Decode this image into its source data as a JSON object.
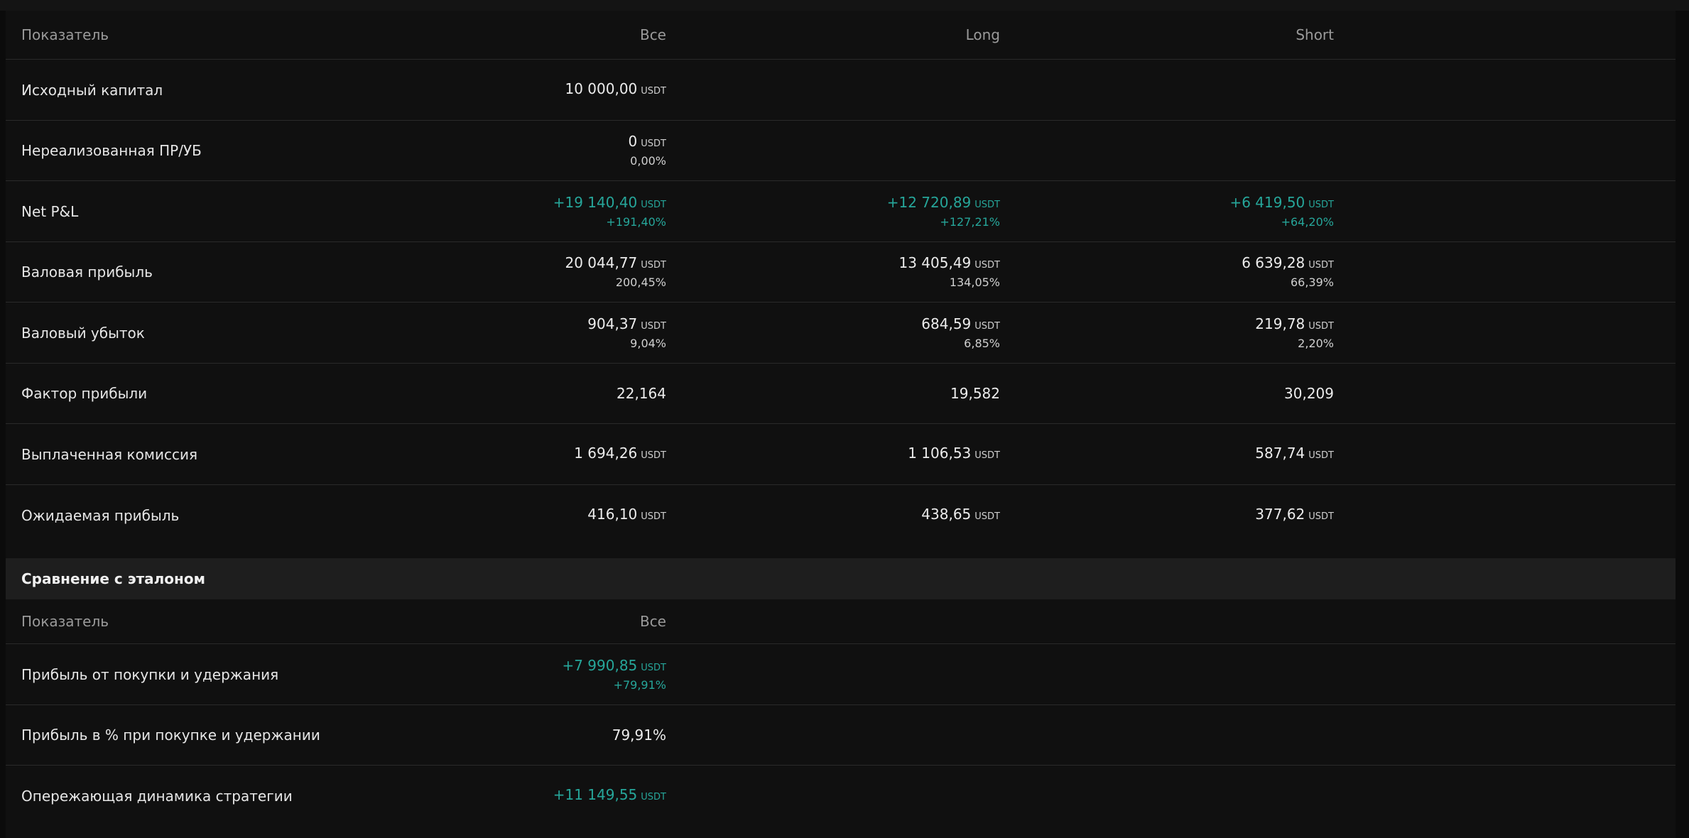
{
  "colors": {
    "positive": "#26a69a",
    "background": "#101010",
    "section_bg": "#1e1e1e"
  },
  "table1": {
    "headers": {
      "metric": "Показатель",
      "all": "Все",
      "long": "Long",
      "short": "Short"
    },
    "rows": [
      {
        "label": "Исходный капитал",
        "all": {
          "value": "10 000,00",
          "unit": "USDT"
        }
      },
      {
        "label": "Нереализованная ПР/УБ",
        "all": {
          "value": "0",
          "unit": "USDT",
          "pct": "0,00%"
        }
      },
      {
        "label": "Net P&L",
        "all": {
          "value": "+19 140,40",
          "unit": "USDT",
          "pct": "+191,40%"
        },
        "long": {
          "value": "+12 720,89",
          "unit": "USDT",
          "pct": "+127,21%"
        },
        "short": {
          "value": "+6 419,50",
          "unit": "USDT",
          "pct": "+64,20%"
        }
      },
      {
        "label": "Валовая прибыль",
        "all": {
          "value": "20 044,77",
          "unit": "USDT",
          "pct": "200,45%"
        },
        "long": {
          "value": "13 405,49",
          "unit": "USDT",
          "pct": "134,05%"
        },
        "short": {
          "value": "6 639,28",
          "unit": "USDT",
          "pct": "66,39%"
        }
      },
      {
        "label": "Валовый убыток",
        "all": {
          "value": "904,37",
          "unit": "USDT",
          "pct": "9,04%"
        },
        "long": {
          "value": "684,59",
          "unit": "USDT",
          "pct": "6,85%"
        },
        "short": {
          "value": "219,78",
          "unit": "USDT",
          "pct": "2,20%"
        }
      },
      {
        "label": "Фактор прибыли",
        "all": {
          "value": "22,164"
        },
        "long": {
          "value": "19,582"
        },
        "short": {
          "value": "30,209"
        }
      },
      {
        "label": "Выплаченная комиссия",
        "all": {
          "value": "1 694,26",
          "unit": "USDT"
        },
        "long": {
          "value": "1 106,53",
          "unit": "USDT"
        },
        "short": {
          "value": "587,74",
          "unit": "USDT"
        }
      },
      {
        "label": "Ожидаемая прибыль",
        "all": {
          "value": "416,10",
          "unit": "USDT"
        },
        "long": {
          "value": "438,65",
          "unit": "USDT"
        },
        "short": {
          "value": "377,62",
          "unit": "USDT"
        }
      }
    ]
  },
  "benchmark": {
    "title": "Сравнение с эталоном",
    "headers": {
      "metric": "Показатель",
      "all": "Все"
    },
    "rows": [
      {
        "label": "Прибыль от покупки и удержания",
        "all": {
          "value": "+7 990,85",
          "unit": "USDT",
          "pct": "+79,91%"
        }
      },
      {
        "label": "Прибыль в % при покупке и удержании",
        "all": {
          "value": "79,91%"
        }
      },
      {
        "label": "Опережающая динамика стратегии",
        "all": {
          "value": "+11 149,55",
          "unit": "USDT"
        }
      }
    ]
  }
}
